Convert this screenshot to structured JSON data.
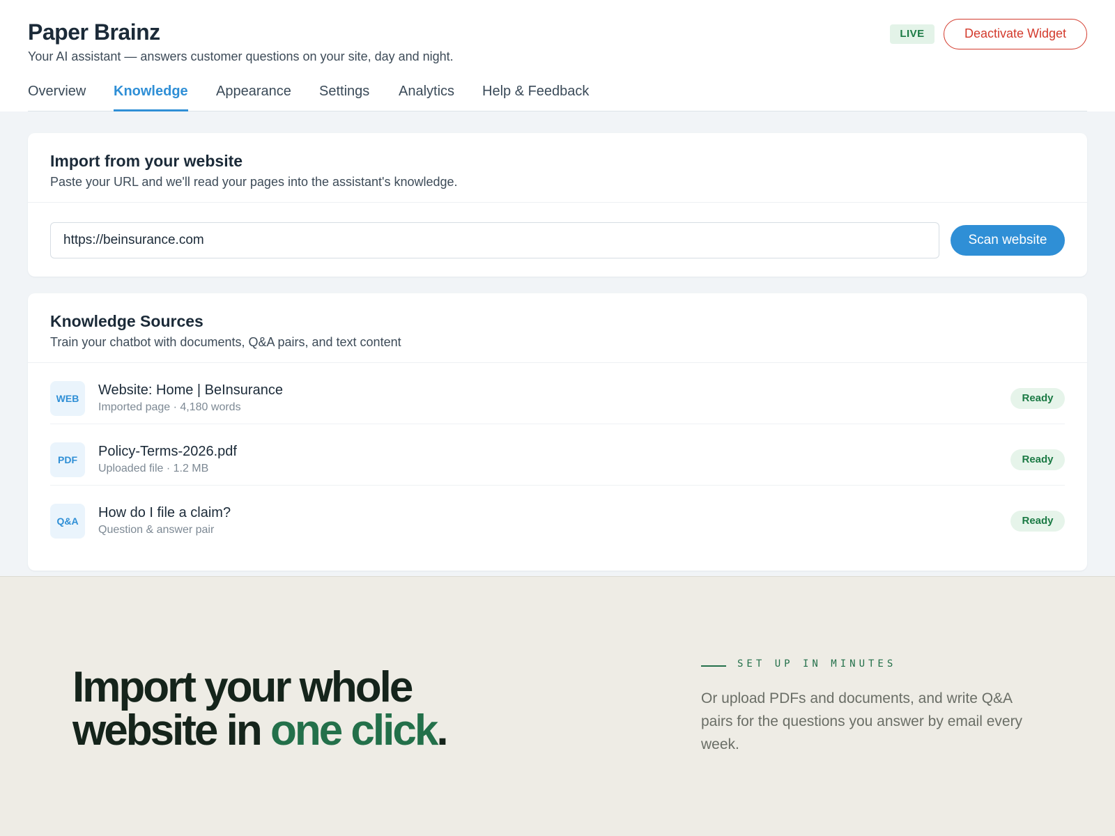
{
  "header": {
    "title": "Paper Brainz",
    "subtitle": "Your AI assistant — answers customer questions on your site, day and night.",
    "live_badge": "LIVE",
    "deactivate_label": "Deactivate Widget"
  },
  "tabs": [
    {
      "label": "Overview",
      "active": false
    },
    {
      "label": "Knowledge",
      "active": true
    },
    {
      "label": "Appearance",
      "active": false
    },
    {
      "label": "Settings",
      "active": false
    },
    {
      "label": "Analytics",
      "active": false
    },
    {
      "label": "Help & Feedback",
      "active": false
    }
  ],
  "import_card": {
    "title": "Import from your website",
    "description": "Paste your URL and we'll read your pages into the assistant's knowledge.",
    "url_value": "https://beinsurance.com",
    "scan_label": "Scan website"
  },
  "sources_card": {
    "title": "Knowledge Sources",
    "description": "Train your chatbot with documents, Q&A pairs, and text content",
    "items": [
      {
        "icon_label": "WEB",
        "name": "Website: Home | BeInsurance",
        "meta": "Imported page · 4,180 words",
        "status": "Ready"
      },
      {
        "icon_label": "PDF",
        "name": "Policy-Terms-2026.pdf",
        "meta": "Uploaded file · 1.2 MB",
        "status": "Ready"
      },
      {
        "icon_label": "Q&A",
        "name": "How do I file a claim?",
        "meta": "Question & answer pair",
        "status": "Ready"
      }
    ]
  },
  "promo": {
    "headline_line1": "Import your whole",
    "headline_line2_prefix": "website in ",
    "headline_accent": "one click",
    "headline_suffix": ".",
    "eyebrow": "SET UP IN MINUTES",
    "body": "Or upload PDFs and documents, and write Q&A pairs for the questions you answer by email every week."
  },
  "colors": {
    "accent": "#2f8fd6",
    "danger": "#d33a2c",
    "success": "#1b7a44",
    "promo_green": "#23704a"
  }
}
